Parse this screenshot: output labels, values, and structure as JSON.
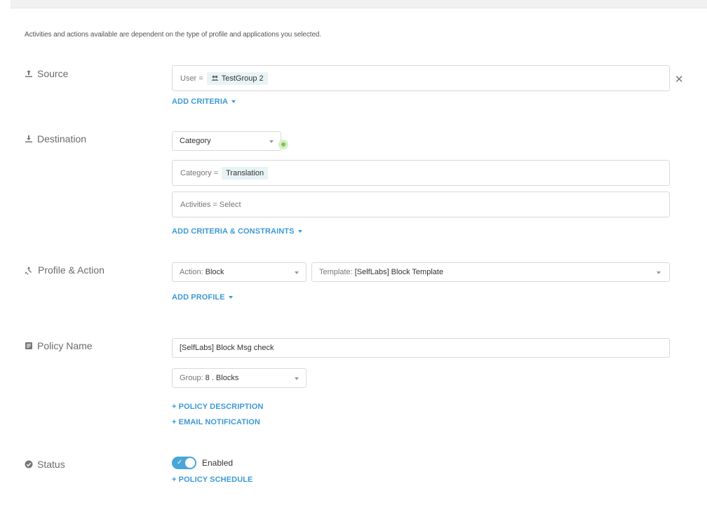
{
  "hint": "Activities and actions available are dependent on the type of profile and applications you selected.",
  "source": {
    "label": "Source",
    "prefix": "User =",
    "chip": "TestGroup 2",
    "add_criteria": "ADD CRITERIA",
    "remove_icon": "close-icon"
  },
  "destination": {
    "label": "Destination",
    "select_value": "Category",
    "category_prefix": "Category =",
    "category_chip": "Translation",
    "activities_placeholder": "Activities = Select",
    "add_link": "ADD CRITERIA & CONSTRAINTS"
  },
  "profile_action": {
    "label": "Profile & Action",
    "action_prefix": "Action:",
    "action_value": "Block",
    "template_prefix": "Template:",
    "template_value": "[SelfLabs] Block Template",
    "add_profile": "ADD PROFILE"
  },
  "policy_name": {
    "label": "Policy Name",
    "value": "[SelfLabs] Block Msg check",
    "group_prefix": "Group:",
    "group_value": "8 . Blocks",
    "description_link": "+ POLICY DESCRIPTION",
    "email_link": "+ EMAIL NOTIFICATION"
  },
  "status": {
    "label": "Status",
    "toggle_label": "Enabled",
    "toggle_on": true,
    "schedule_link": "+ POLICY SCHEDULE"
  },
  "colors": {
    "accent": "#3d9ad6",
    "chip_bg": "#e8f3f6",
    "toggle_on": "#4aa5d8",
    "focus_dot": "#7cc45a"
  }
}
